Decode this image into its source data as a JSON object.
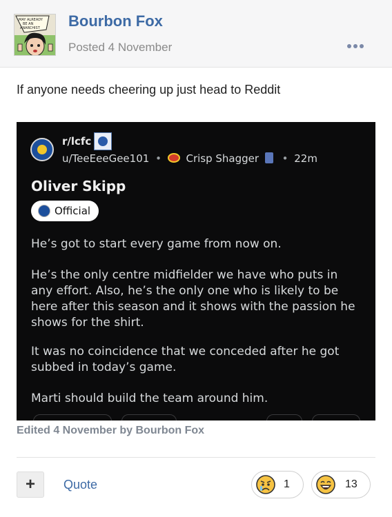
{
  "post": {
    "author": "Bourbon Fox",
    "posted": "Posted 4 November",
    "avatar_caption": "MAY ALREADY BE AN ANARCHIST",
    "body": "If anyone needs cheering up just head to Reddit",
    "edited": "Edited 4 November by Bourbon Fox"
  },
  "embed": {
    "subreddit": "r/lcfc",
    "username": "u/TeeEeeGee101",
    "separator": "•",
    "user_flair": "Crisp Shagger",
    "age": "22m",
    "title": "Oliver Skipp",
    "post_flair": "Official",
    "paragraphs": [
      "He’s got to start every game from now on.",
      "He’s the only centre midfielder we have who puts in any effort. Also, he’s the only one who is likely to be here after this season and it shows with the passion he shows for the shirt.",
      "It was no coincidence that we conceded after he got subbed in today’s game.",
      "Marti should build the team around him."
    ]
  },
  "actions": {
    "plus_label": "+",
    "quote_label": "Quote",
    "reactions": [
      {
        "icon": "worried-face-icon",
        "count": "1"
      },
      {
        "icon": "laughing-face-icon",
        "count": "13"
      }
    ]
  },
  "colors": {
    "author_blue": "#3d6aa5",
    "embed_bg": "#0b0b0c",
    "header_bg": "#f6f6f7"
  }
}
